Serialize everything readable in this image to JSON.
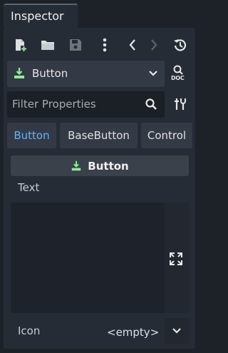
{
  "dock": {
    "tab_label": "Inspector"
  },
  "toolbar": {
    "new_resource_icon": "file-plus-icon",
    "open_icon": "folder-icon",
    "save_icon": "save-icon",
    "more_icon": "vertical-dots-icon",
    "back_icon": "chevron-left-icon",
    "forward_icon": "chevron-right-icon",
    "history_icon": "history-icon"
  },
  "object_selector": {
    "label": "Button",
    "doc_label": "DOC"
  },
  "filter": {
    "placeholder": "Filter Properties"
  },
  "class_tabs": [
    {
      "label": "Button",
      "active": true
    },
    {
      "label": "BaseButton",
      "active": false
    },
    {
      "label": "Control",
      "active": false
    }
  ],
  "section": {
    "title": "Button"
  },
  "properties": {
    "text_label": "Text",
    "text_value": "",
    "icon_label": "Icon",
    "icon_value": "<empty>"
  },
  "colors": {
    "accent": "#5fb2ff",
    "node_green": "#8eef97",
    "panel": "#262c36",
    "background": "#1d2229"
  }
}
